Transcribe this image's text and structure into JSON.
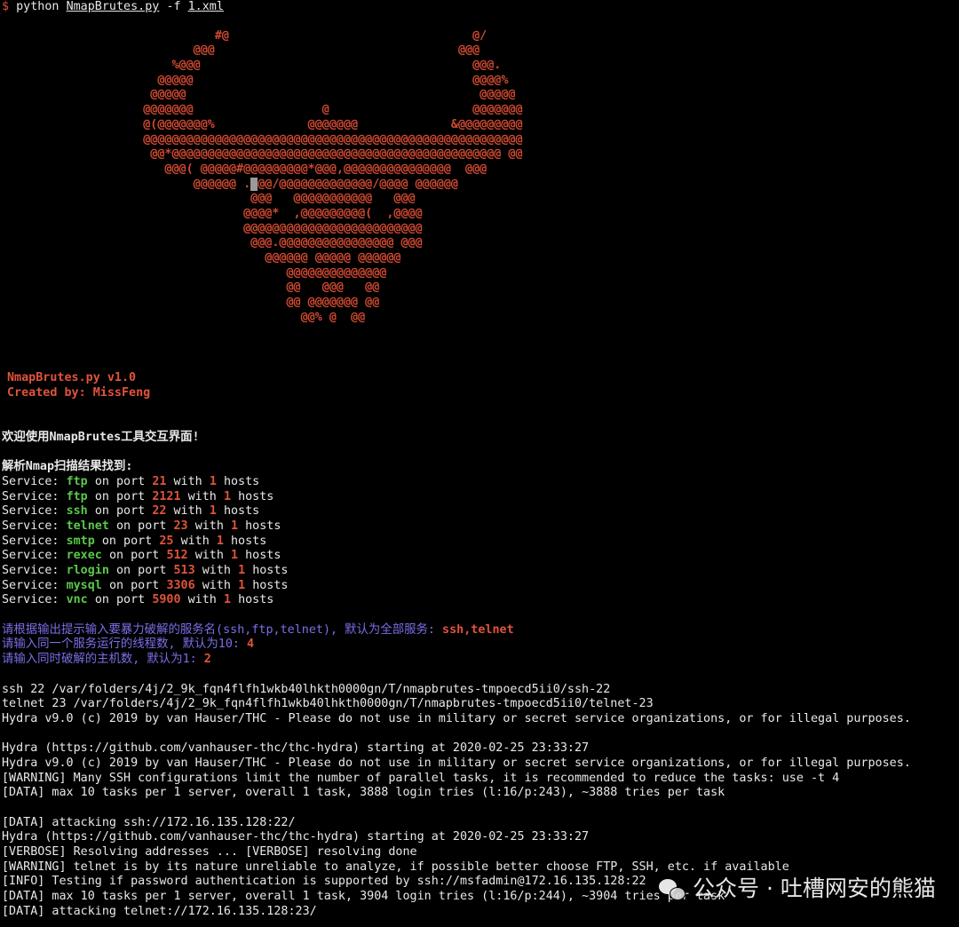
{
  "prompt": {
    "symbol": "$",
    "cmd": "python",
    "script": "NmapBrutes.py",
    "flag": "-f",
    "file": "1.xml"
  },
  "art": {
    "l01": "                              #@                                  @/",
    "l02": "                           @@@                                  @@@",
    "l03": "                        %@@@                                      @@@.",
    "l04": "                      @@@@@                                       @@@@%",
    "l05": "                     @@@@@                                         @@@@@",
    "l06": "                    @@@@@@@                  @                    @@@@@@@",
    "l07": "                    @(@@@@@@@%             @@@@@@@             &@@@@@@@@@",
    "l08": "                    @@@@@@@@@@@@@@@@@@@@@@@@@@@@@@@@@@@@@@@@@@@@@@@@@@@@@",
    "l09": "                     @@*@@@@@@@@@@@@@@@@@@@@@@@@@@@@@@@@@@@@@@@@@@@@@@ @@",
    "l10": "                       @@@( @@@@@#@@@@@@@@@*@@@,@@@@@@@@@@@@@@@  @@@",
    "l11_a": "                           @@@@@@ .",
    "l11_b": "@",
    "l11_c": "@@/@@@@@@@@@@@@@/@@@@ @@@@@@",
    "l12": "                                   @@@   @@@@@@@@@@@   @@@",
    "l13": "                                  @@@@*  ,@@@@@@@@@(  ,@@@@",
    "l14": "                                  @@@@@@@@@@@@@@@@@@@@@@@@@",
    "l15": "                                   @@@.@@@@@@@@@@@@@@@@ @@@",
    "l16": "                                     @@@@@@ @@@@@ @@@@@@",
    "l17": "                                        @@@@@@@@@@@@@@",
    "l18": "                                        @@   @@@   @@",
    "l19": "                                        @@ @@@@@@@ @@",
    "l20": "                                          @@% @  @@"
  },
  "banner": {
    "title": "NmapBrutes.py v1.0",
    "author": "Created by: MissFeng"
  },
  "welcome": "欢迎使用NmapBrutes工具交互界面!",
  "parse_header": "解析Nmap扫描结果找到:",
  "labels": {
    "service": "Service:",
    "on_port": "on port",
    "with": "with",
    "hosts": "hosts"
  },
  "services": [
    {
      "name": "ftp",
      "port": "21",
      "count": "1"
    },
    {
      "name": "ftp",
      "port": "2121",
      "count": "1"
    },
    {
      "name": "ssh",
      "port": "22",
      "count": "1"
    },
    {
      "name": "telnet",
      "port": "23",
      "count": "1"
    },
    {
      "name": "smtp",
      "port": "25",
      "count": "1"
    },
    {
      "name": "rexec",
      "port": "512",
      "count": "1"
    },
    {
      "name": "rlogin",
      "port": "513",
      "count": "1"
    },
    {
      "name": "mysql",
      "port": "3306",
      "count": "1"
    },
    {
      "name": "vnc",
      "port": "5900",
      "count": "1"
    }
  ],
  "prompts": [
    {
      "question": "请根据输出提示输入要暴力破解的服务名(ssh,ftp,telnet), 默认为全部服务: ",
      "answer": "ssh,telnet"
    },
    {
      "question": "请输入同一个服务运行的线程数, 默认为10: ",
      "answer": "4"
    },
    {
      "question": "请输入同时破解的主机数, 默认为1: ",
      "answer": "2"
    }
  ],
  "log": {
    "l01": "ssh 22 /var/folders/4j/2_9k_fqn4flfh1wkb40lhkth0000gn/T/nmapbrutes-tmpoecd5ii0/ssh-22",
    "l02": "telnet 23 /var/folders/4j/2_9k_fqn4flfh1wkb40lhkth0000gn/T/nmapbrutes-tmpoecd5ii0/telnet-23",
    "l03": "Hydra v9.0 (c) 2019 by van Hauser/THC - Please do not use in military or secret service organizations, or for illegal purposes.",
    "l04": "",
    "l05": "Hydra (https://github.com/vanhauser-thc/thc-hydra) starting at 2020-02-25 23:33:27",
    "l06": "Hydra v9.0 (c) 2019 by van Hauser/THC - Please do not use in military or secret service organizations, or for illegal purposes.",
    "l07": "[WARNING] Many SSH configurations limit the number of parallel tasks, it is recommended to reduce the tasks: use -t 4",
    "l08": "[DATA] max 10 tasks per 1 server, overall 1 task, 3888 login tries (l:16/p:243), ~3888 tries per task",
    "l09": "",
    "l10": "[DATA] attacking ssh://172.16.135.128:22/",
    "l11": "Hydra (https://github.com/vanhauser-thc/thc-hydra) starting at 2020-02-25 23:33:27",
    "l12": "[VERBOSE] Resolving addresses ... [VERBOSE] resolving done",
    "l13": "[WARNING] telnet is by its nature unreliable to analyze, if possible better choose FTP, SSH, etc. if available",
    "l14": "[INFO] Testing if password authentication is supported by ssh://msfadmin@172.16.135.128:22",
    "l15": "[DATA] max 10 tasks per 1 server, overall 1 task, 3904 login tries (l:16/p:244), ~3904 tries per task",
    "l16": "[DATA] attacking telnet://172.16.135.128:23/"
  },
  "watermark": {
    "text": "公众号 · 吐槽网安的熊猫",
    "icon": "wechat-icon"
  }
}
